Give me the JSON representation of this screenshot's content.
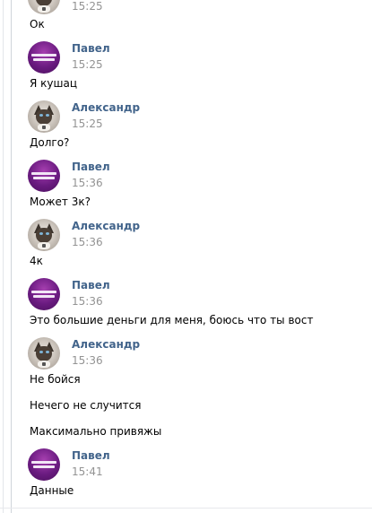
{
  "messages": [
    {
      "time": "15:25",
      "text": "Ок"
    },
    {
      "author": "Павел",
      "time": "15:25",
      "text": "Я кушац"
    },
    {
      "author": "Александр",
      "time": "15:25",
      "text": "Долго?"
    },
    {
      "author": "Павел",
      "time": "15:36",
      "text": "Может 3к?"
    },
    {
      "author": "Александр",
      "time": "15:36",
      "text": "4к"
    },
    {
      "author": "Павел",
      "time": "15:36",
      "text": "Это большие деньги для меня, боюсь что ты вост"
    },
    {
      "author": "Александр",
      "time": "15:36",
      "text": "Не бойся"
    },
    {
      "text": "Нечего не случится"
    },
    {
      "text": "Максимально привяжы"
    },
    {
      "author": "Павел",
      "time": "15:41",
      "text": "Данные"
    }
  ]
}
